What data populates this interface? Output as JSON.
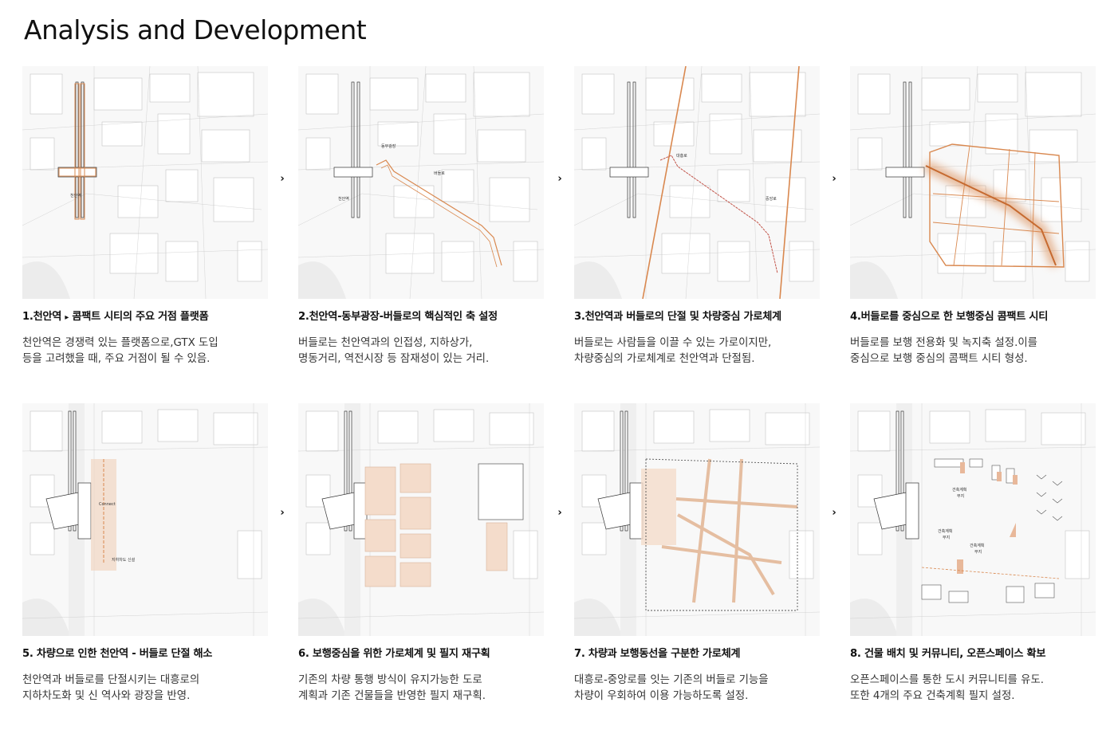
{
  "page": {
    "title": "Analysis and Development"
  },
  "flow_arrow_glyph": "›",
  "accent_color": "#d9884f",
  "panels": [
    {
      "title_pre": "1.천안역",
      "title_marker": "▸",
      "title_post": "콤팩트 시티의 주요 거점 플랫폼",
      "body": [
        "천안역은 경쟁력 있는 플랫폼으로,GTX 도입",
        "등을 고려했을 때, 주요 거점이 될 수 있음."
      ],
      "map_labels": [
        "천안역"
      ]
    },
    {
      "title": "2.천안역-동부광장-버들로의 핵심적인 축 설정",
      "body": [
        "버들로는 천안역과의 인접성, 지하상가,",
        "명동거리, 역전시장 등 잠재성이 있는 거리."
      ],
      "map_labels": [
        "동부광장",
        "버들로",
        "천안역"
      ]
    },
    {
      "title": "3.천안역과 버들로의 단절 및 차량중심 가로체계",
      "body": [
        "버들로는 사람들을 이끌 수 있는 가로이지만,",
        "차량중심의 가로체계로 천안역과 단절됨."
      ],
      "map_labels": [
        "대흥로",
        "중앙로"
      ]
    },
    {
      "title": "4.버들로를 중심으로 한 보행중심 콤팩트 시티",
      "body": [
        "버들로를 보행 전용화 및 녹지축 설정.이를",
        "중심으로 보행 중심의 콤팩트 시티 형성."
      ],
      "map_labels": []
    },
    {
      "title": "5. 차량으로 인한 천안역 - 버들로 단절 해소",
      "body": [
        "천안역과 버들로를 단절시키는 대흥로의",
        "지하차도화 및 신 역사와 광장을 반영."
      ],
      "map_labels": [
        "Connect",
        "지하차도 신설"
      ]
    },
    {
      "title": "6. 보행중심을 위한 가로체계 및 필지 재구획",
      "body": [
        "기존의 차량 통행 방식이 유지가능한 도로",
        "계획과 기존 건물들을 반영한 필지 재구획."
      ],
      "map_labels": []
    },
    {
      "title": "7. 차량과 보행동선을 구분한 가로체계",
      "body": [
        "대흥로-중앙로를 잇는 기존의 버들로 기능을",
        "차량이 우회하여 이용 가능하도록 설정."
      ],
      "map_labels": []
    },
    {
      "title": "8. 건물 배치 및 커뮤니티, 오픈스페이스 확보",
      "body": [
        "오픈스페이스를 통한 도시 커뮤니티를 유도.",
        "또한 4개의 주요 건축계획 필지 설정."
      ],
      "map_labels": [
        "건축계획",
        "부지",
        "건축계획",
        "부지",
        "건축계획",
        "부지"
      ]
    }
  ]
}
